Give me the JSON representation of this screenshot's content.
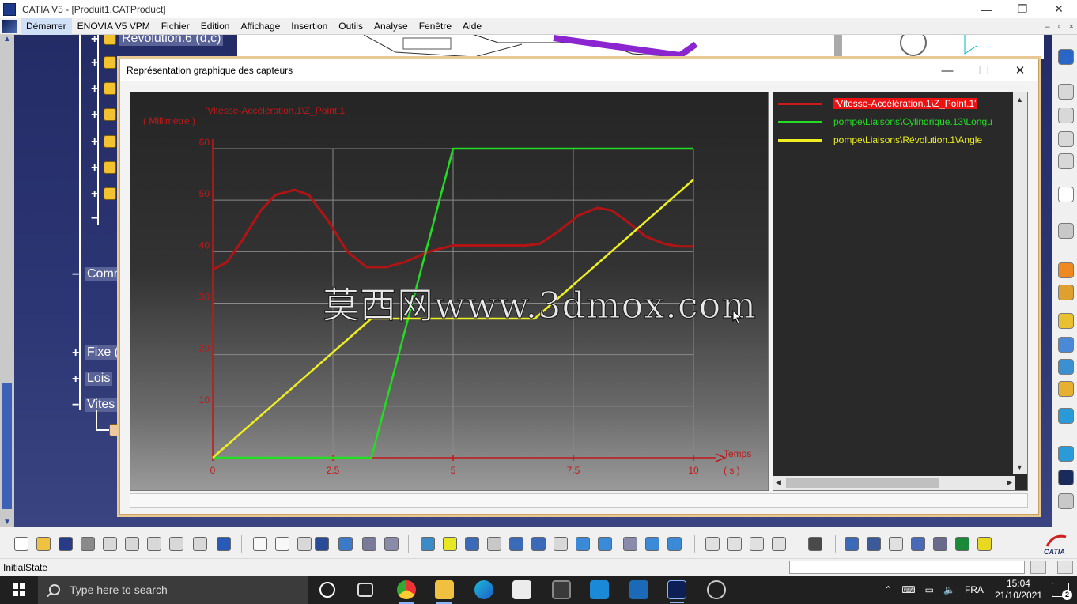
{
  "window": {
    "title": "CATIA V5 - [Produit1.CATProduct]",
    "controls": {
      "minimize": "—",
      "maximize": "❐",
      "close": "✕"
    }
  },
  "menu": {
    "items": [
      "Démarrer",
      "ENOVIA V5 VPM",
      "Fichier",
      "Edition",
      "Affichage",
      "Insertion",
      "Outils",
      "Analyse",
      "Fenêtre",
      "Aide"
    ],
    "mdi_controls": {
      "minimize": "–",
      "restore": "▫",
      "close": "×"
    }
  },
  "tree": {
    "top_node": "Révolution.6 (d,c)",
    "nodes": [
      "Comm",
      "Fixe (",
      "Lois",
      "Vites"
    ]
  },
  "dialog": {
    "title": "Représentation graphique des capteurs",
    "controls": {
      "minimize": "—",
      "maximize": "☐",
      "close": "✕"
    }
  },
  "legend": {
    "entries": [
      {
        "label": "'Vitesse-Accélération.1\\Z_Point.1'",
        "color": "#cc1a1a",
        "selected": true
      },
      {
        "label": "pompe\\Liaisons\\Cylindrique.13\\Longu",
        "color": "#22dd22",
        "selected": false
      },
      {
        "label": "pompe\\Liaisons\\Révolution.1\\Angle",
        "color": "#eeee22",
        "selected": false
      }
    ]
  },
  "chart_data": {
    "type": "line",
    "title": "'Vitesse-Accélération.1\\Z_Point.1'",
    "ylabel": "( Millimètre )",
    "xlabel": "Temps",
    "xunit": "( s )",
    "xlim": [
      0,
      10
    ],
    "ylim": [
      0,
      60
    ],
    "x_ticks": [
      0,
      2.5,
      5,
      7.5,
      10
    ],
    "x_tick_labels": [
      "0",
      "2.5",
      "5",
      "7.5",
      "10"
    ],
    "y_ticks": [
      10,
      20,
      30,
      40,
      50,
      60
    ],
    "y_tick_labels": [
      "10",
      "20",
      "30",
      "40",
      "50",
      "60"
    ],
    "grid": true,
    "series": [
      {
        "name": "'Vitesse-Accélération.1\\Z_Point.1'",
        "color": "#b01414",
        "x": [
          0,
          0.3,
          0.6,
          1.0,
          1.3,
          1.7,
          2.0,
          2.4,
          2.8,
          3.2,
          3.6,
          4.0,
          4.5,
          5.0,
          5.5,
          6.0,
          6.5,
          6.8,
          7.2,
          7.6,
          8.0,
          8.3,
          8.6,
          9.0,
          9.4,
          9.7,
          10
        ],
        "y": [
          36.5,
          38,
          42,
          48,
          51,
          52,
          51,
          46,
          40,
          37,
          37,
          38,
          40,
          41.2,
          41.2,
          41.2,
          41.2,
          41.5,
          44,
          47,
          48.5,
          48,
          46,
          43,
          41.5,
          41,
          41
        ]
      },
      {
        "name": "pompe\\Liaisons\\Cylindrique.13\\Longu",
        "color": "#22dd22",
        "x": [
          0,
          3.3,
          5.0,
          10
        ],
        "y": [
          0,
          0,
          60,
          60
        ]
      },
      {
        "name": "pompe\\Liaisons\\Révolution.1\\Angle",
        "color": "#eeee22",
        "x": [
          0,
          3.3,
          6.7,
          10
        ],
        "y": [
          0,
          27,
          27,
          54
        ]
      }
    ]
  },
  "status": {
    "text": "InitialState"
  },
  "taskbar": {
    "search_placeholder": "Type here to search",
    "language": "FRA",
    "time": "15:04",
    "date": "21/10/2021",
    "notifications": "2"
  },
  "watermark": "莫西网www.3dmox.com"
}
